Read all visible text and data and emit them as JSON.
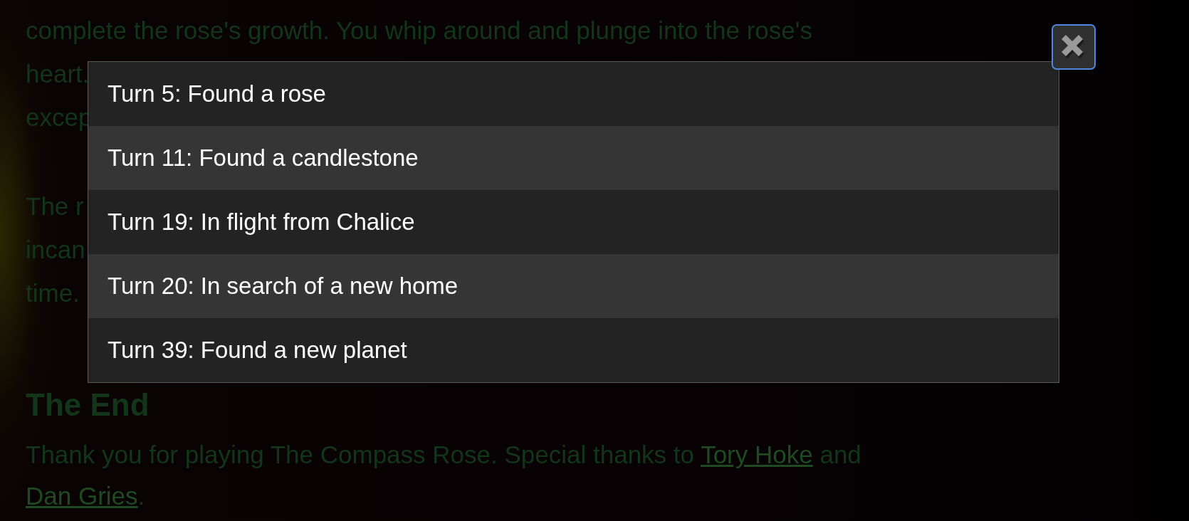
{
  "story": {
    "lines": [
      "complete the rose's growth. You whip around and plunge into the rose's",
      "heart.",
      "excep"
    ],
    "lines_2": [
      "The r",
      "incan",
      "time."
    ],
    "heading": "The End",
    "credits": [
      {
        "kind": "text",
        "text": "Thank you for playing The Compass Rose. Special thanks to "
      },
      {
        "kind": "link",
        "text": "Tory Hoke"
      },
      {
        "kind": "text",
        "text": " and "
      },
      {
        "kind": "link",
        "text": "Dan Gries"
      },
      {
        "kind": "text",
        "text": "."
      }
    ]
  },
  "turn_log": {
    "items": [
      "Turn 5: Found a rose",
      "Turn 11: Found a candlestone",
      "Turn 19: In flight from Chalice",
      "Turn 20: In search of a new home",
      "Turn 39: Found a new planet"
    ]
  },
  "close_button": {
    "focused": true
  }
}
